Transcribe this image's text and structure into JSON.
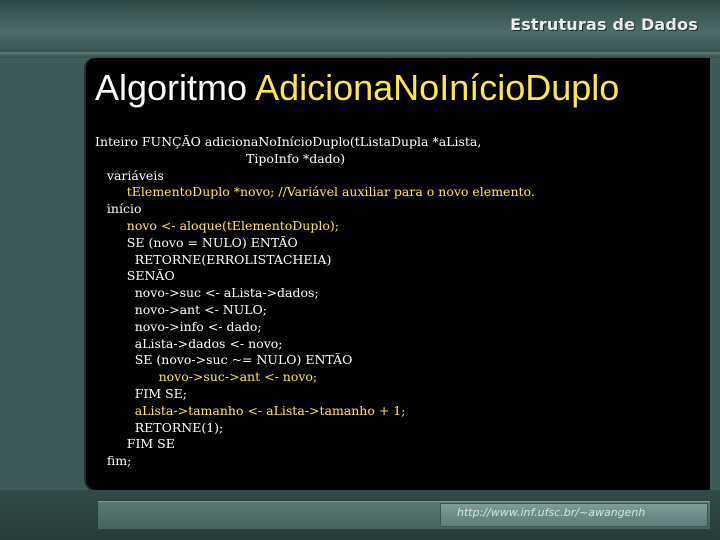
{
  "header": {
    "brand": "Estruturas de Dados"
  },
  "slide": {
    "title_part1": "Algoritmo",
    "title_part2": "AdicionaNoInícioDuplo",
    "code": {
      "l01": "Inteiro FUNÇÃO adicionaNoInícioDuplo(tListaDupla *aLista,",
      "l02": "                                      TipoInfo *dado)",
      "l03": "   variáveis",
      "l04": "        tElementoDuplo *novo; ",
      "l04_comment": "//Variável auxiliar para o novo elemento.",
      "l05": "   início",
      "l06": "        novo <- aloque(tElementoDuplo);",
      "l07": "        SE (novo = NULO) ENTÃO",
      "l08": "          RETORNE(ERROLISTACHEIA)",
      "l09": "        SENÃO",
      "l10": "          novo->suc <- aLista->dados;",
      "l11": "          novo->ant <- NULO;",
      "l12": "          novo->info <- dado;",
      "l13": "          aLista->dados <- novo;",
      "l14": "          SE (novo->suc ~= NULO) ENTÃO",
      "l15": "                novo->suc->ant <- novo;",
      "l16": "          FIM SE;",
      "l17": "          aLista->tamanho <- aLista->tamanho + 1;",
      "l18": "          RETORNE(1);",
      "l19": "        FIM SE",
      "l20": "   fim;"
    }
  },
  "footer": {
    "url": "http://www.inf.ufsc.br/~awangenh"
  },
  "colors": {
    "frame": "#3f5a57",
    "panel": "#000000",
    "title_accent": "#fde74c",
    "text": "#ffffff"
  }
}
